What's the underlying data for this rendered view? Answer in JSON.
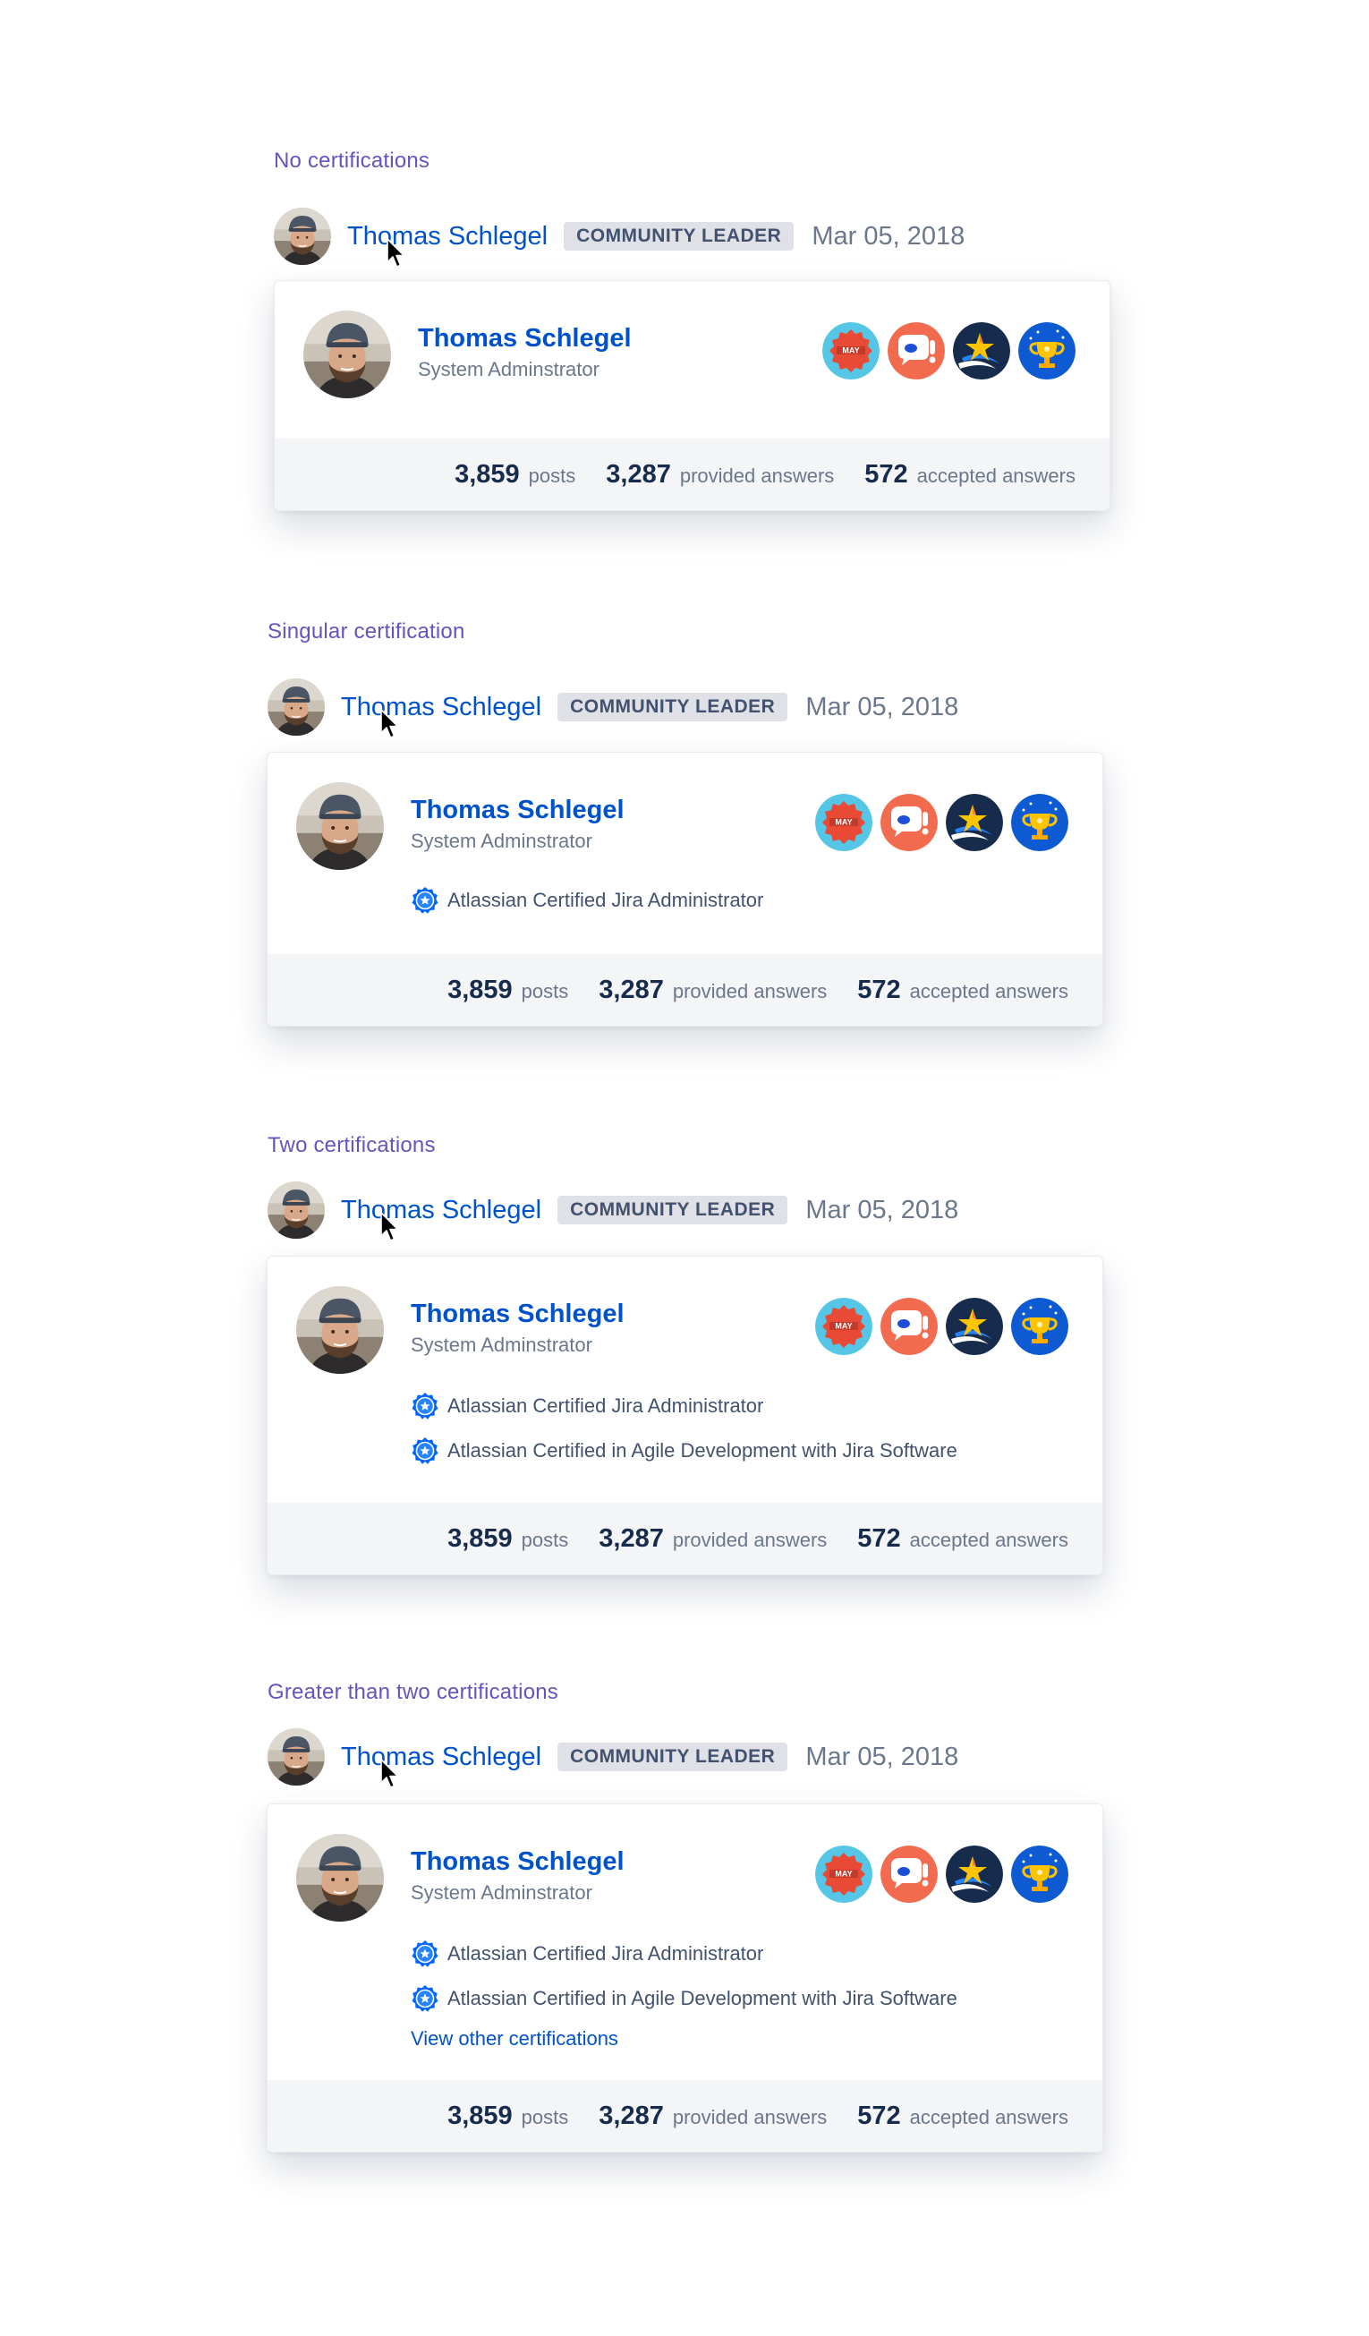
{
  "user": {
    "name": "Thomas Schlegel",
    "role": "System Adminstrator",
    "badge": "COMMUNITY LEADER",
    "date": "Mar 05, 2018",
    "avatar_icon": "user-photo-avatar"
  },
  "achievement_badges": [
    {
      "icon": "may-badge-icon",
      "text": "MAY",
      "bg": "#55c6e6"
    },
    {
      "icon": "question-bubble-badge-icon",
      "bg": "#f26b4f"
    },
    {
      "icon": "shooting-star-badge-icon",
      "bg": "#172b4d"
    },
    {
      "icon": "trophy-badge-icon",
      "bg": "#0e5ad3"
    }
  ],
  "stats": {
    "posts": {
      "value": "3,859",
      "label": "posts"
    },
    "provided": {
      "value": "3,287",
      "label": "provided answers"
    },
    "accepted": {
      "value": "572",
      "label": "accepted answers"
    }
  },
  "sections": [
    {
      "title": "No certifications",
      "certifications": []
    },
    {
      "title": "Singular certification",
      "certifications": [
        "Atlassian Certified Jira Administrator"
      ]
    },
    {
      "title": "Two certifications",
      "certifications": [
        "Atlassian Certified Jira Administrator",
        "Atlassian Certified in Agile Development with Jira Software"
      ]
    },
    {
      "title": "Greater than two certifications",
      "certifications": [
        "Atlassian Certified Jira Administrator",
        "Atlassian Certified in Agile Development with Jira Software"
      ],
      "view_more": "View other certifications"
    }
  ],
  "colors": {
    "accent": "#0052cc",
    "section_title": "#6554c0",
    "cert_icon": "#0065ff"
  }
}
